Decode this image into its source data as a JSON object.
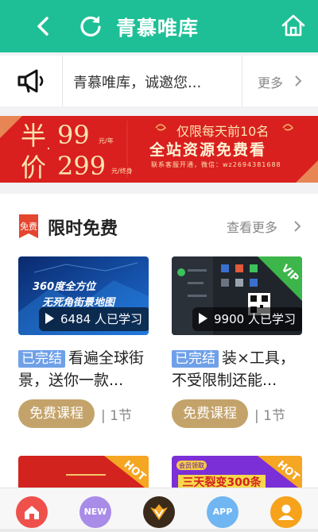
{
  "header": {
    "title": "青慕唯库",
    "bg_color": "#1ebf96"
  },
  "notice": {
    "text": "青慕唯库，诚邀您...",
    "more": "更多"
  },
  "banner": {
    "char_ban": "半",
    "char_jia": "价",
    "price_year": "99",
    "unit_year": "元/年",
    "price_life": "299",
    "unit_life": "元/终身",
    "limit_text": "仅限每天前10名",
    "main_text": "全站资源免费看",
    "contact_text": "联系客服开通，微信：wz2694381688"
  },
  "section": {
    "icon_label": "免费",
    "title": "限时免费",
    "more": "查看更多"
  },
  "courses": [
    {
      "thumb_title_1": "360度全方位",
      "thumb_title_2": "无死角街景地图",
      "learners": "6484 人已学习",
      "status": "已完结",
      "title": "看遍全球街景，送你一款...",
      "price_label": "免费课程",
      "lessons": "| 1节"
    },
    {
      "thumb_badge": "VIP",
      "learners": "9900 人已学习",
      "status": "已完结",
      "title": "装×工具，不受限制还能...",
      "price_label": "免费课程",
      "lessons": "| 1节"
    }
  ],
  "more_courses": [
    {
      "badge": "HOT"
    },
    {
      "badge": "HOT",
      "tag": "会员领取",
      "headline": "三天裂变300条"
    }
  ],
  "bottom_nav": [
    {
      "name": "home",
      "label": "",
      "color": "#f0504b"
    },
    {
      "name": "new",
      "label": "NEW",
      "color": "#a98be8"
    },
    {
      "name": "vip",
      "label": "",
      "color": "#3a2a1a"
    },
    {
      "name": "app",
      "label": "APP",
      "color": "#6fb6f2"
    },
    {
      "name": "user",
      "label": "",
      "color": "#f6a21a"
    }
  ]
}
